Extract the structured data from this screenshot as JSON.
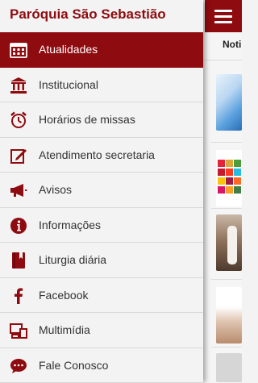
{
  "app": {
    "title": "Paróquia São Sebastião",
    "accent_color": "#8e0b0f"
  },
  "background": {
    "menu_icon": "hamburger-icon",
    "tab_label": "Noti"
  },
  "menu": {
    "items": [
      {
        "label": "Atualidades",
        "icon": "calendar-icon",
        "active": true
      },
      {
        "label": "Institucional",
        "icon": "institution-icon",
        "active": false
      },
      {
        "label": "Horários de missas",
        "icon": "alarm-clock-icon",
        "active": false
      },
      {
        "label": "Atendimento secretaria",
        "icon": "edit-icon",
        "active": false
      },
      {
        "label": "Avisos",
        "icon": "megaphone-icon",
        "active": false
      },
      {
        "label": "Informações",
        "icon": "info-icon",
        "active": false
      },
      {
        "label": "Liturgia diária",
        "icon": "book-icon",
        "active": false
      },
      {
        "label": "Facebook",
        "icon": "facebook-icon",
        "active": false
      },
      {
        "label": "Multimídia",
        "icon": "multimedia-icon",
        "active": false
      },
      {
        "label": "Fale Conosco",
        "icon": "chat-icon",
        "active": false
      }
    ]
  }
}
